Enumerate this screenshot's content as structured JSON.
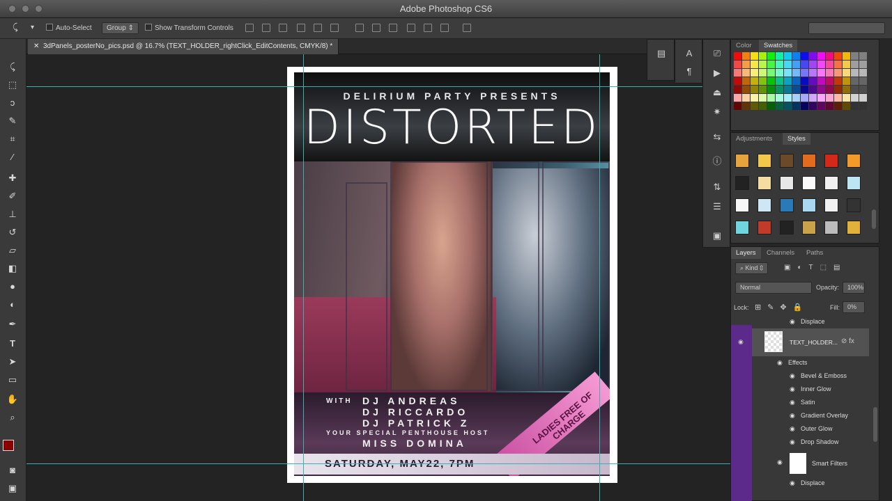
{
  "app": {
    "title": "Adobe Photoshop CS6"
  },
  "options": {
    "auto_select_label": "Auto-Select",
    "group_value": "Group",
    "transform_label": "Show Transform Controls"
  },
  "document": {
    "tab_label": "3dPanels_posterNo_pics.psd @ 16.7% (TEXT_HOLDER_rightClick_EditContents, CMYK/8) *"
  },
  "poster": {
    "presents": "DELIRIUM PARTY PRESENTS",
    "headline": "DISTORTED",
    "with": "WITH",
    "dj1": "DJ ANDREAS",
    "dj2": "DJ RICCARDO",
    "dj3": "DJ PATRICK Z",
    "host_label": "YOUR SPECIAL PENTHOUSE HOST",
    "host": "MISS DOMINA",
    "date": "SATURDAY, MAY22, 7PM",
    "ladies": "LADIES FREE OF CHARGE"
  },
  "panels": {
    "color_tab": "Color",
    "swatches_tab": "Swatches",
    "adjustments_tab": "Adjustments",
    "styles_tab": "Styles",
    "layers_tab": "Layers",
    "channels_tab": "Channels",
    "paths_tab": "Paths",
    "kind_value": "Kind",
    "blend_value": "Normal",
    "opacity_label": "Opacity:",
    "opacity_value": "100%",
    "lock_label": "Lock:",
    "fill_label": "Fill:",
    "fill_value": "0%"
  },
  "layers": {
    "displace_top": "Displace",
    "text_holder": "TEXT_HOLDER...",
    "effects": "Effects",
    "effect_items": [
      "Bevel & Emboss",
      "Inner Glow",
      "Satin",
      "Gradient Overlay",
      "Outer Glow",
      "Drop Shadow"
    ],
    "smart_filters": "Smart Filters",
    "displace_bottom": "Displace"
  },
  "colors": {
    "guide": "#3ab0b3",
    "foreground": "#8b0000",
    "layer_selected": "#5b2a8a"
  }
}
